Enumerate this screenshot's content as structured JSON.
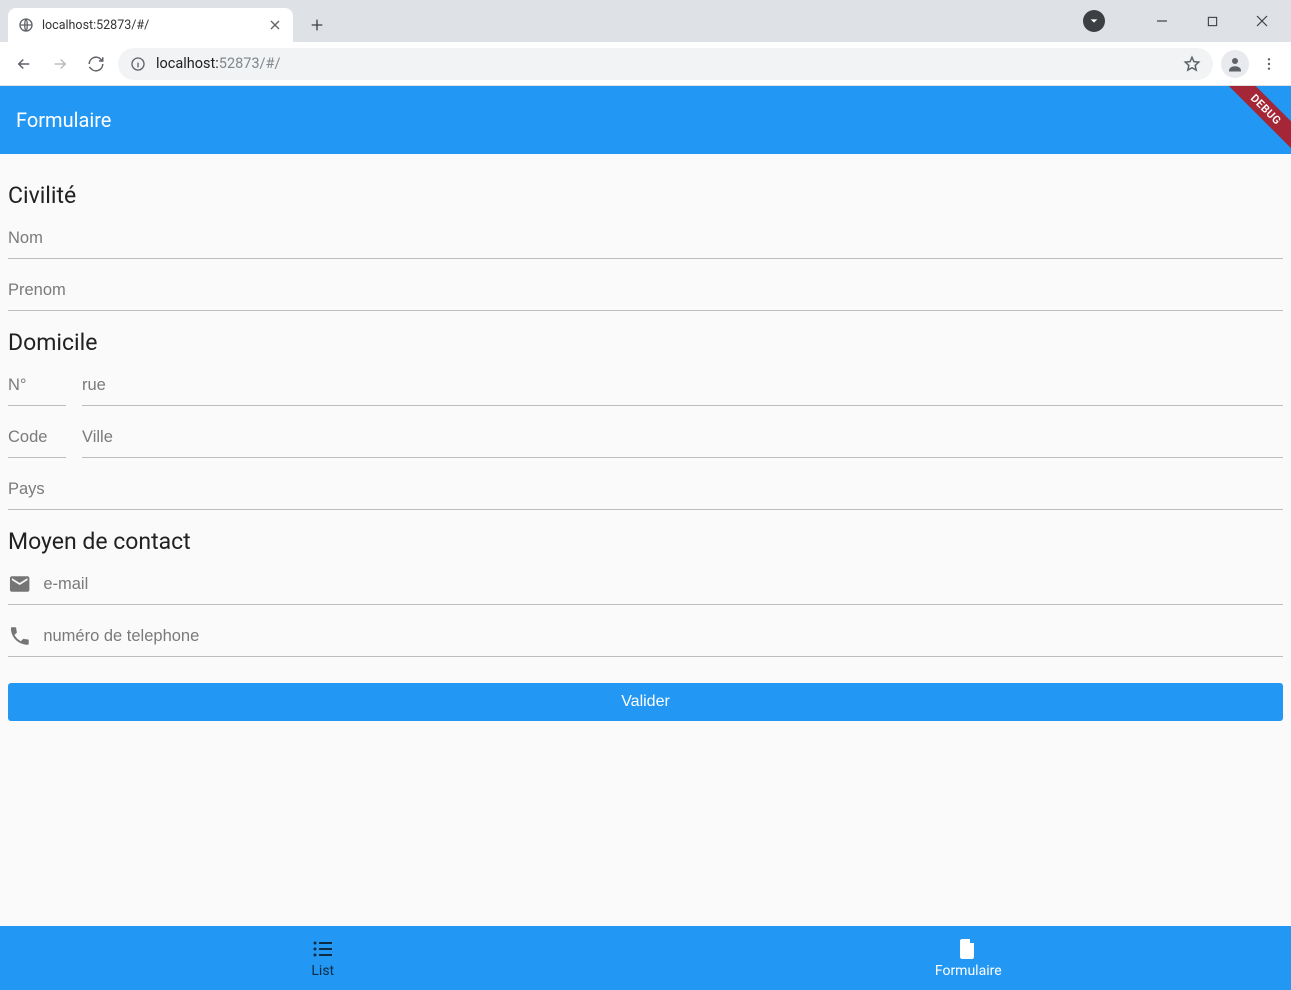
{
  "browser": {
    "tab_title": "localhost:52873/#/",
    "url_host": "localhost:",
    "url_port_path": "52873/#/"
  },
  "appbar": {
    "title": "Formulaire",
    "debug_label": "DEBUG"
  },
  "sections": {
    "civilite": {
      "title": "Civilité",
      "nom_placeholder": "Nom",
      "prenom_placeholder": "Prenom"
    },
    "domicile": {
      "title": "Domicile",
      "numero_placeholder": "N°",
      "rue_placeholder": "rue",
      "code_placeholder": "Code",
      "ville_placeholder": "Ville",
      "pays_placeholder": "Pays"
    },
    "contact": {
      "title": "Moyen de contact",
      "email_placeholder": "e-mail",
      "phone_placeholder": "numéro de telephone"
    }
  },
  "submit_label": "Valider",
  "bottom_nav": {
    "list_label": "List",
    "form_label": "Formulaire"
  }
}
